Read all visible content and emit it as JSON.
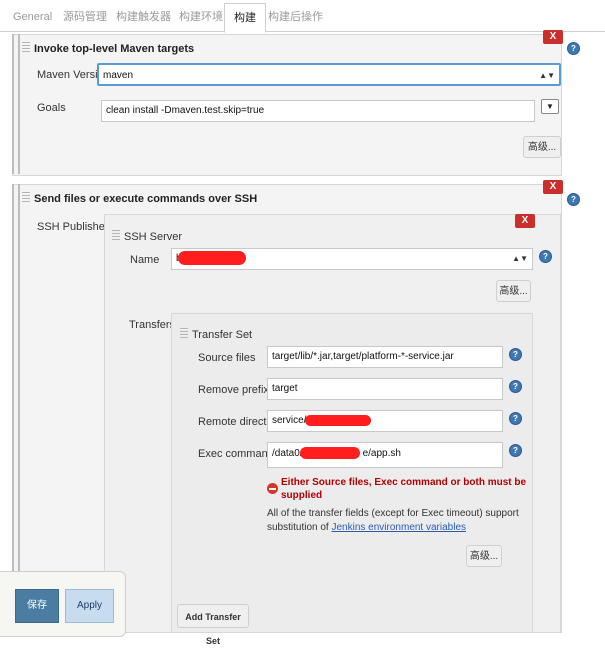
{
  "tabs": [
    "General",
    "源码管理",
    "构建触发器",
    "构建环境",
    "构建",
    "构建后操作"
  ],
  "maven_section": {
    "title": "Invoke top-level Maven targets",
    "close_label": "X",
    "maven_version_label": "Maven Version",
    "maven_version_value": "maven",
    "goals_label": "Goals",
    "goals_value": "clean install -Dmaven.test.skip=true",
    "expand_label": "▼",
    "advanced_label": "高级..."
  },
  "ssh_section": {
    "title": "Send files or execute commands over SSH",
    "close_label": "X",
    "publishers_label": "SSH Publishers",
    "server": {
      "title": "SSH Server",
      "close_label": "X",
      "name_label": "Name",
      "name_value": "b",
      "advanced_label": "高级..."
    },
    "transfers_label": "Transfers",
    "transfer_set": {
      "title": "Transfer Set",
      "source_files_label": "Source files",
      "source_files_value": "target/lib/*.jar,target/platform-*-service.jar",
      "remove_prefix_label": "Remove prefix",
      "remove_prefix_value": "target",
      "remote_directory_label": "Remote directory",
      "remote_directory_value": "service/platfo",
      "exec_command_label": "Exec command",
      "exec_command_prefix": "/data0/",
      "exec_command_suffix": "e/app.sh",
      "error_line1": "Either Source files, Exec command or both must be",
      "error_line2": "supplied",
      "note_line1": "All of the transfer fields (except for Exec timeout) support",
      "note_prefix": "substitution of",
      "note_link": "Jenkins environment variables",
      "advanced_label": "高级..."
    },
    "add_transfer_label": "Add Transfer Set"
  },
  "footer": {
    "save_label": "保存",
    "apply_label": "Apply"
  },
  "colors": {
    "close_red": "#c9302c",
    "help_blue": "#3d78b5",
    "error_red": "#b40000",
    "save_blue": "#4b7da3",
    "apply_blue": "#c8dcef",
    "focus_blue": "#5b9bd5"
  },
  "icons": [
    "question-mark-help-icon",
    "drag-handle-icon",
    "error-minus-icon",
    "select-arrows-icon"
  ]
}
